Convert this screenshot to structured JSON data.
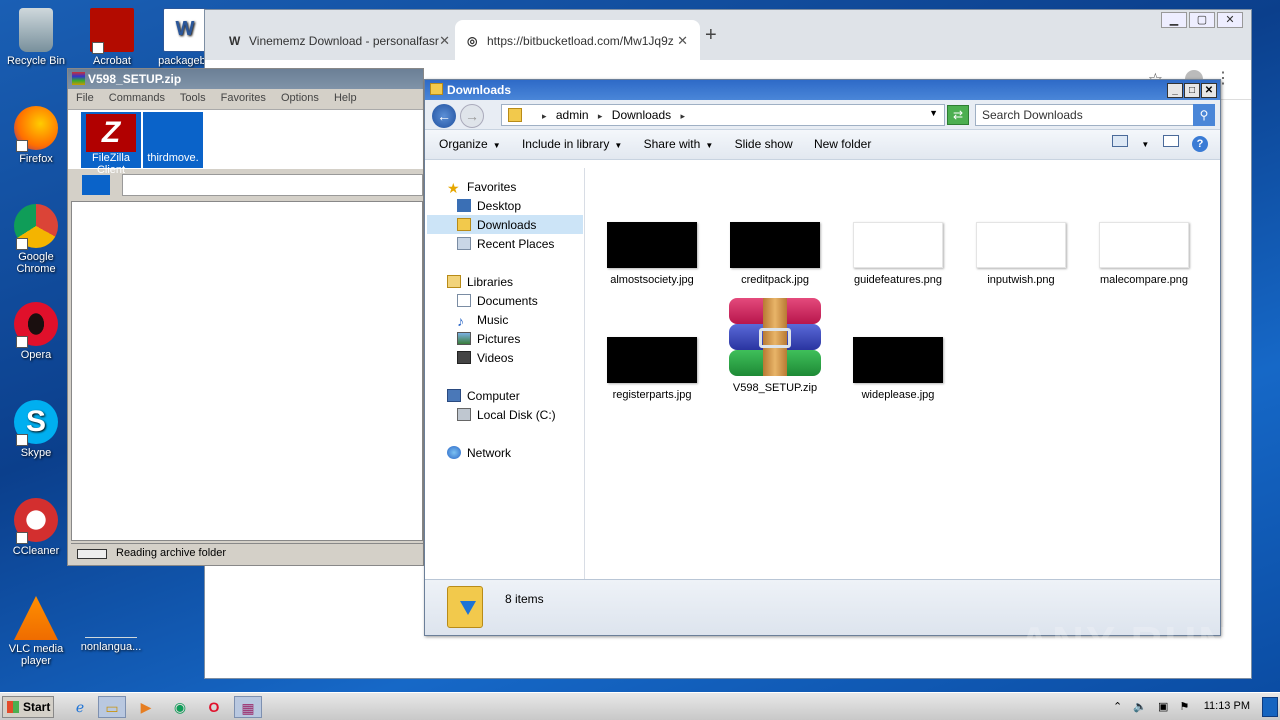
{
  "desktop": {
    "icons": [
      {
        "label": "Recycle Bin",
        "icon": "recycle-bin-icon"
      },
      {
        "label": "Firefox",
        "icon": "firefox-icon"
      },
      {
        "label": "Google Chrome",
        "icon": "chrome-icon"
      },
      {
        "label": "Opera",
        "icon": "opera-icon"
      },
      {
        "label": "Skype",
        "icon": "skype-icon"
      },
      {
        "label": "CCleaner",
        "icon": "ccleaner-icon"
      },
      {
        "label": "VLC media player",
        "icon": "vlc-icon"
      },
      {
        "label": "Acrobat",
        "icon": "acrobat-icon"
      },
      {
        "label": "packagebir",
        "icon": "word-doc-icon"
      },
      {
        "label": "nonlangua...",
        "icon": "blank-file-icon"
      }
    ]
  },
  "browser": {
    "tabs": [
      {
        "label": "Vinememz Download - personalfasr",
        "active": false
      },
      {
        "label": "https://bitbucketload.com/Mw1Jq9z",
        "active": true
      }
    ],
    "new_tab": "+"
  },
  "winrar": {
    "title": "V598_SETUP.zip",
    "menu": [
      "File",
      "Commands",
      "Tools",
      "Favorites",
      "Options",
      "Help"
    ],
    "toolbar_items": [
      "FileZilla Client",
      "thirdmove."
    ],
    "status": "Reading archive folder"
  },
  "explorer": {
    "title": "Downloads",
    "breadcrumb": [
      "admin",
      "Downloads"
    ],
    "search_placeholder": "Search Downloads",
    "commands": [
      "Organize",
      "Include in library",
      "Share with",
      "Slide show",
      "New folder"
    ],
    "nav": {
      "favorites_header": "Favorites",
      "favorites": [
        "Desktop",
        "Downloads",
        "Recent Places"
      ],
      "libraries_header": "Libraries",
      "libraries": [
        "Documents",
        "Music",
        "Pictures",
        "Videos"
      ],
      "computer_header": "Computer",
      "computer": [
        "Local Disk (C:)"
      ],
      "network_header": "Network"
    },
    "selected_nav": "Downloads",
    "files": [
      {
        "name": "almostsociety.jpg",
        "thumb": "black"
      },
      {
        "name": "creditpack.jpg",
        "thumb": "black"
      },
      {
        "name": "guidefeatures.png",
        "thumb": "white"
      },
      {
        "name": "inputwish.png",
        "thumb": "white"
      },
      {
        "name": "malecompare.png",
        "thumb": "white"
      },
      {
        "name": "registerparts.jpg",
        "thumb": "black"
      },
      {
        "name": "V598_SETUP.zip",
        "thumb": "winrar"
      },
      {
        "name": "wideplease.jpg",
        "thumb": "black"
      }
    ],
    "item_count": "8 items"
  },
  "taskbar": {
    "start": "Start",
    "clock": "11:13 PM"
  },
  "watermark": "ANY RUN"
}
